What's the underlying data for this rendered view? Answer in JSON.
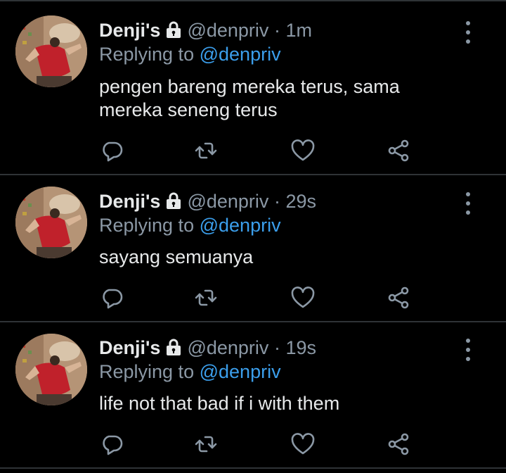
{
  "tweets": [
    {
      "name": "Denji's",
      "handle": "@denpriv",
      "dot": "·",
      "time": "1m",
      "replying_prefix": "Replying to",
      "replying_to": "@denpriv",
      "text_lines": [
        "pengen bareng mereka terus, sama",
        "mereka seneng terus"
      ]
    },
    {
      "name": "Denji's",
      "handle": "@denpriv",
      "dot": "·",
      "time": "29s",
      "replying_prefix": "Replying to",
      "replying_to": "@denpriv",
      "text_lines": [
        "sayang semuanya"
      ]
    },
    {
      "name": "Denji's",
      "handle": "@denpriv",
      "dot": "·",
      "time": "19s",
      "replying_prefix": "Replying to",
      "replying_to": "@denpriv",
      "text_lines": [
        "life not that bad if i with them"
      ]
    }
  ],
  "icons": {
    "lock": "lock-icon",
    "more": "more-vertical-icon",
    "reply": "reply-icon",
    "retweet": "retweet-icon",
    "like": "heart-icon",
    "share": "share-icon"
  },
  "colors": {
    "background": "#000000",
    "divider": "#2f3336",
    "secondary_text": "#8b98a5",
    "mention": "#3b9eeb",
    "primary_text": "#e7e9ea"
  }
}
